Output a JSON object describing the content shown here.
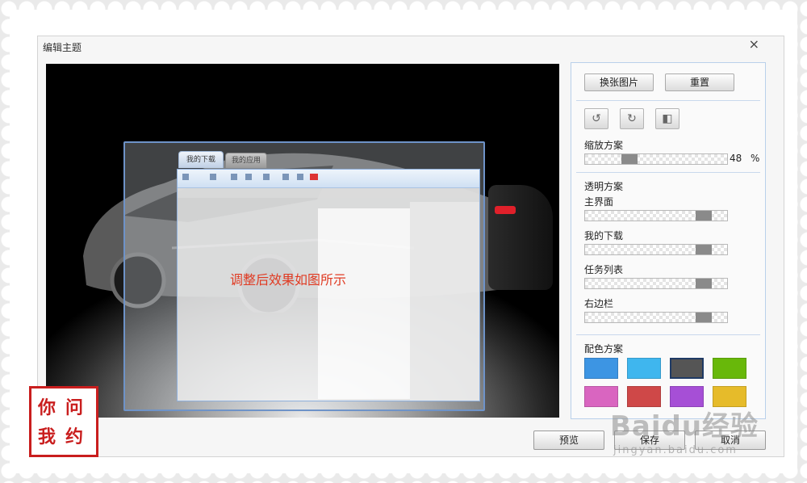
{
  "dialog": {
    "title": "编辑主题",
    "close_label": "×"
  },
  "preview": {
    "annotation": "调整后效果如图所示",
    "tabs": [
      "我的下载",
      "我的应用"
    ]
  },
  "panel": {
    "change_image_label": "换张图片",
    "reset_label": "重置",
    "zoom_section": "缩放方案",
    "zoom_value": "48",
    "zoom_unit": "%",
    "zoom_level": 0.48,
    "transparency_section": "透明方案",
    "transparency_items": [
      {
        "label": "主界面",
        "level": 0.88
      },
      {
        "label": "我的下载",
        "level": 0.88
      },
      {
        "label": "任务列表",
        "level": 0.88
      },
      {
        "label": "右边栏",
        "level": 0.88
      }
    ],
    "color_section": "配色方案",
    "colors": [
      {
        "name": "blue",
        "hex": "#3d95e3"
      },
      {
        "name": "sky",
        "hex": "#3fb6ee"
      },
      {
        "name": "graphite",
        "hex": "#555555",
        "selected": true
      },
      {
        "name": "green",
        "hex": "#68b80a"
      },
      {
        "name": "pink",
        "hex": "#d965c0"
      },
      {
        "name": "red",
        "hex": "#cf4848"
      },
      {
        "name": "purple",
        "hex": "#a64fd6"
      },
      {
        "name": "gold",
        "hex": "#e6bb2a"
      }
    ]
  },
  "footer": {
    "preview_label": "预览",
    "save_label": "保存",
    "cancel_label": "取消"
  },
  "seal": {
    "chars": [
      "你",
      "问",
      "我",
      "约"
    ]
  },
  "watermark": {
    "brand": "Baidu经验",
    "url": "jingyan.baidu.com"
  }
}
